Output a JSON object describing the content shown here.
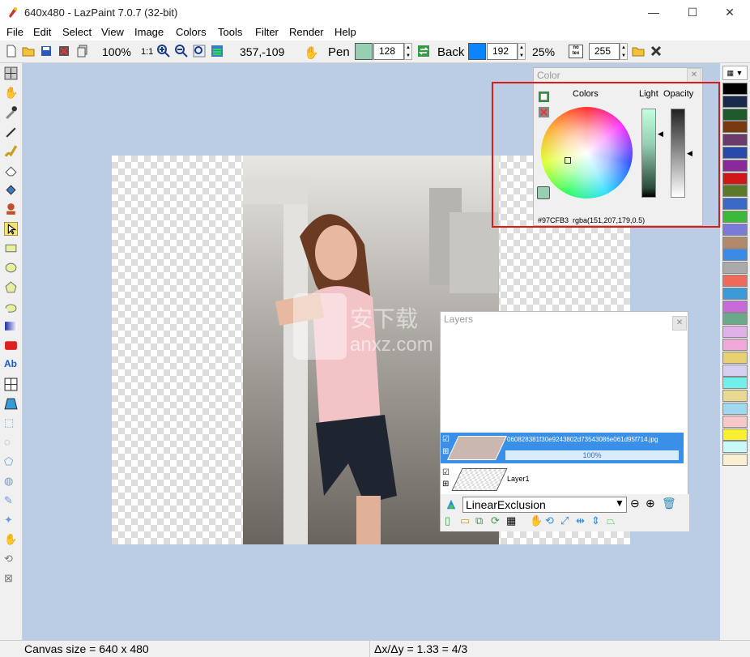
{
  "window": {
    "title": "640x480 - LazPaint 7.0.7 (32-bit)",
    "minimize": "—",
    "maximize": "☐",
    "close": "✕"
  },
  "menu": [
    "File",
    "Edit",
    "Select",
    "View",
    "Image",
    "Colors",
    "Tools",
    "Filter",
    "Render",
    "Help"
  ],
  "toolbar": {
    "zoom": "100%",
    "zoom_1to1": "1:1",
    "coords": "357,-109",
    "pen_label": "Pen",
    "pen_alpha": "128",
    "pen_color": "#97CFB3",
    "back_label": "Back",
    "back_alpha": "192",
    "back_color": "#0a84ff",
    "percent": "25%",
    "notex_label": "no tex",
    "tex_alpha": "255"
  },
  "color_panel": {
    "title": "Color",
    "colors_label": "Colors",
    "light_label": "Light",
    "opacity_label": "Opacity",
    "hex": "#97CFB3",
    "rgba": "rgba(151,207,179,0.5)"
  },
  "layers_panel": {
    "title": "Layers",
    "layers": [
      {
        "name": "060828381f30e9243802d73543086e061d95f714.jpg",
        "opacity": "100%",
        "selected": true
      },
      {
        "name": "Layer1",
        "opacity": "",
        "selected": false
      }
    ],
    "blend_mode": "LinearExclusion"
  },
  "watermark": {
    "text1": "安下载",
    "text2": "anxz.com"
  },
  "status": {
    "canvas_size": "Canvas size = 640 x 480",
    "ratio": "Δx/Δy = 1.33 = 4/3"
  },
  "palette_colors": [
    "#000000",
    "#1a2a4a",
    "#1e5a2a",
    "#7a3a10",
    "#6a3a6a",
    "#2a4aaa",
    "#8a2a9a",
    "#d01818",
    "#5a7a2a",
    "#3a6ac8",
    "#3ab83a",
    "#7a7ad8",
    "#b08a6a",
    "#3a8ae8",
    "#aaaaaa",
    "#f06a5a",
    "#3a9ad8",
    "#c86ad8",
    "#6aaa8a",
    "#e0b0e8",
    "#f0a8d8",
    "#e8d070",
    "#d8d0f0",
    "#70f0e8",
    "#e8d890",
    "#a0d8f0",
    "#f8c8c8",
    "#f8f030",
    "#c8f8f8",
    "#f8f0d0"
  ]
}
